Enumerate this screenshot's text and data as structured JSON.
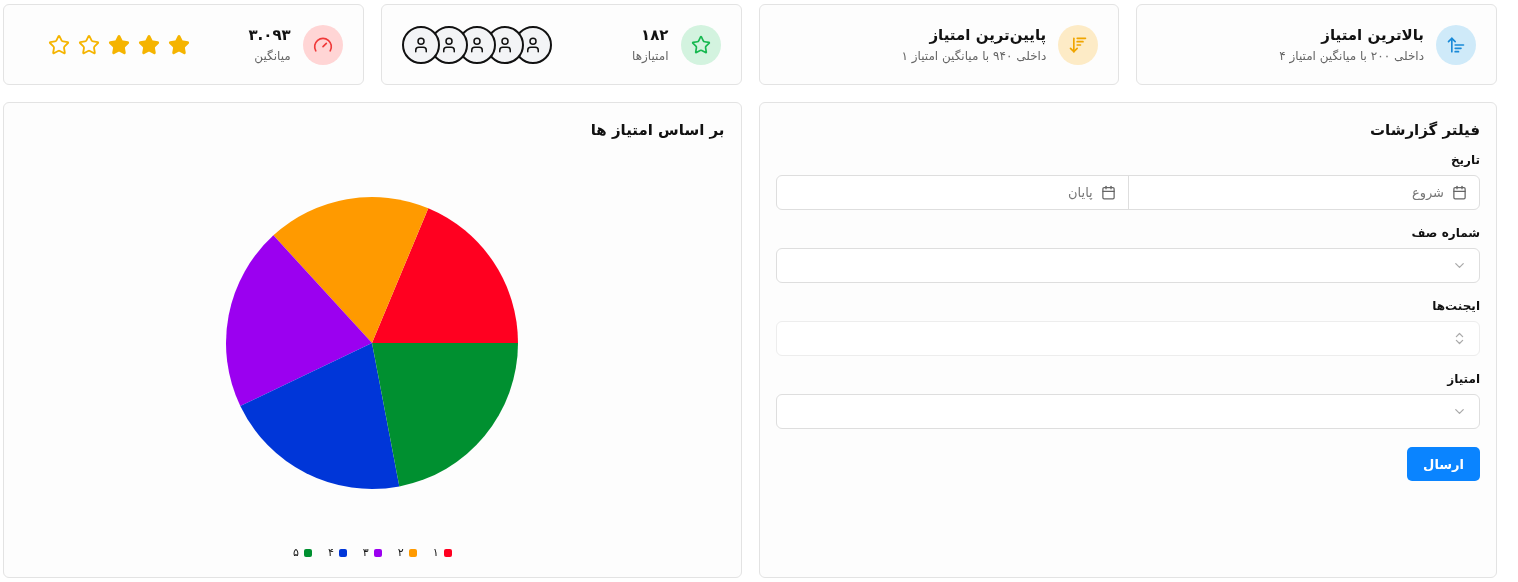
{
  "stats": [
    {
      "kind": "highest",
      "title": "بالاترین امتیاز",
      "subtitle": "داخلی ۲۰۰ با میانگین امتیاز ۴"
    },
    {
      "kind": "lowest",
      "title": "پایین‌ترین امتیاز",
      "subtitle": "داخلی ۹۴۰ با میانگین امتیاز ۱"
    },
    {
      "kind": "count",
      "title": "۱۸۲",
      "subtitle": "امتیازها"
    },
    {
      "kind": "average",
      "title": "۳.۰۹۳",
      "subtitle": "میانگین",
      "stars": 3
    }
  ],
  "filter": {
    "title": "فیلتر گزارشات",
    "fields": [
      {
        "kind": "daterange",
        "label": "تاریخ",
        "start_placeholder": "شروع",
        "end_placeholder": "پایان"
      },
      {
        "kind": "select",
        "label": "شماره صف"
      },
      {
        "kind": "multiselect",
        "label": "ایجنت‌ها"
      },
      {
        "kind": "select",
        "label": "امتیاز"
      }
    ],
    "submit": "ارسال"
  },
  "chart": {
    "title": "بر اساس امتیاز ها",
    "chart_data": {
      "type": "pie",
      "categories": [
        "۱",
        "۲",
        "۳",
        "۴",
        "۵"
      ],
      "series": [
        {
          "colors": [
            "#ff0020",
            "#ff9a00",
            "#9b00f0",
            "#0036d8",
            "#009030"
          ],
          "values": [
            18.7,
            18.1,
            20.3,
            20.9,
            22.0
          ]
        }
      ]
    }
  }
}
